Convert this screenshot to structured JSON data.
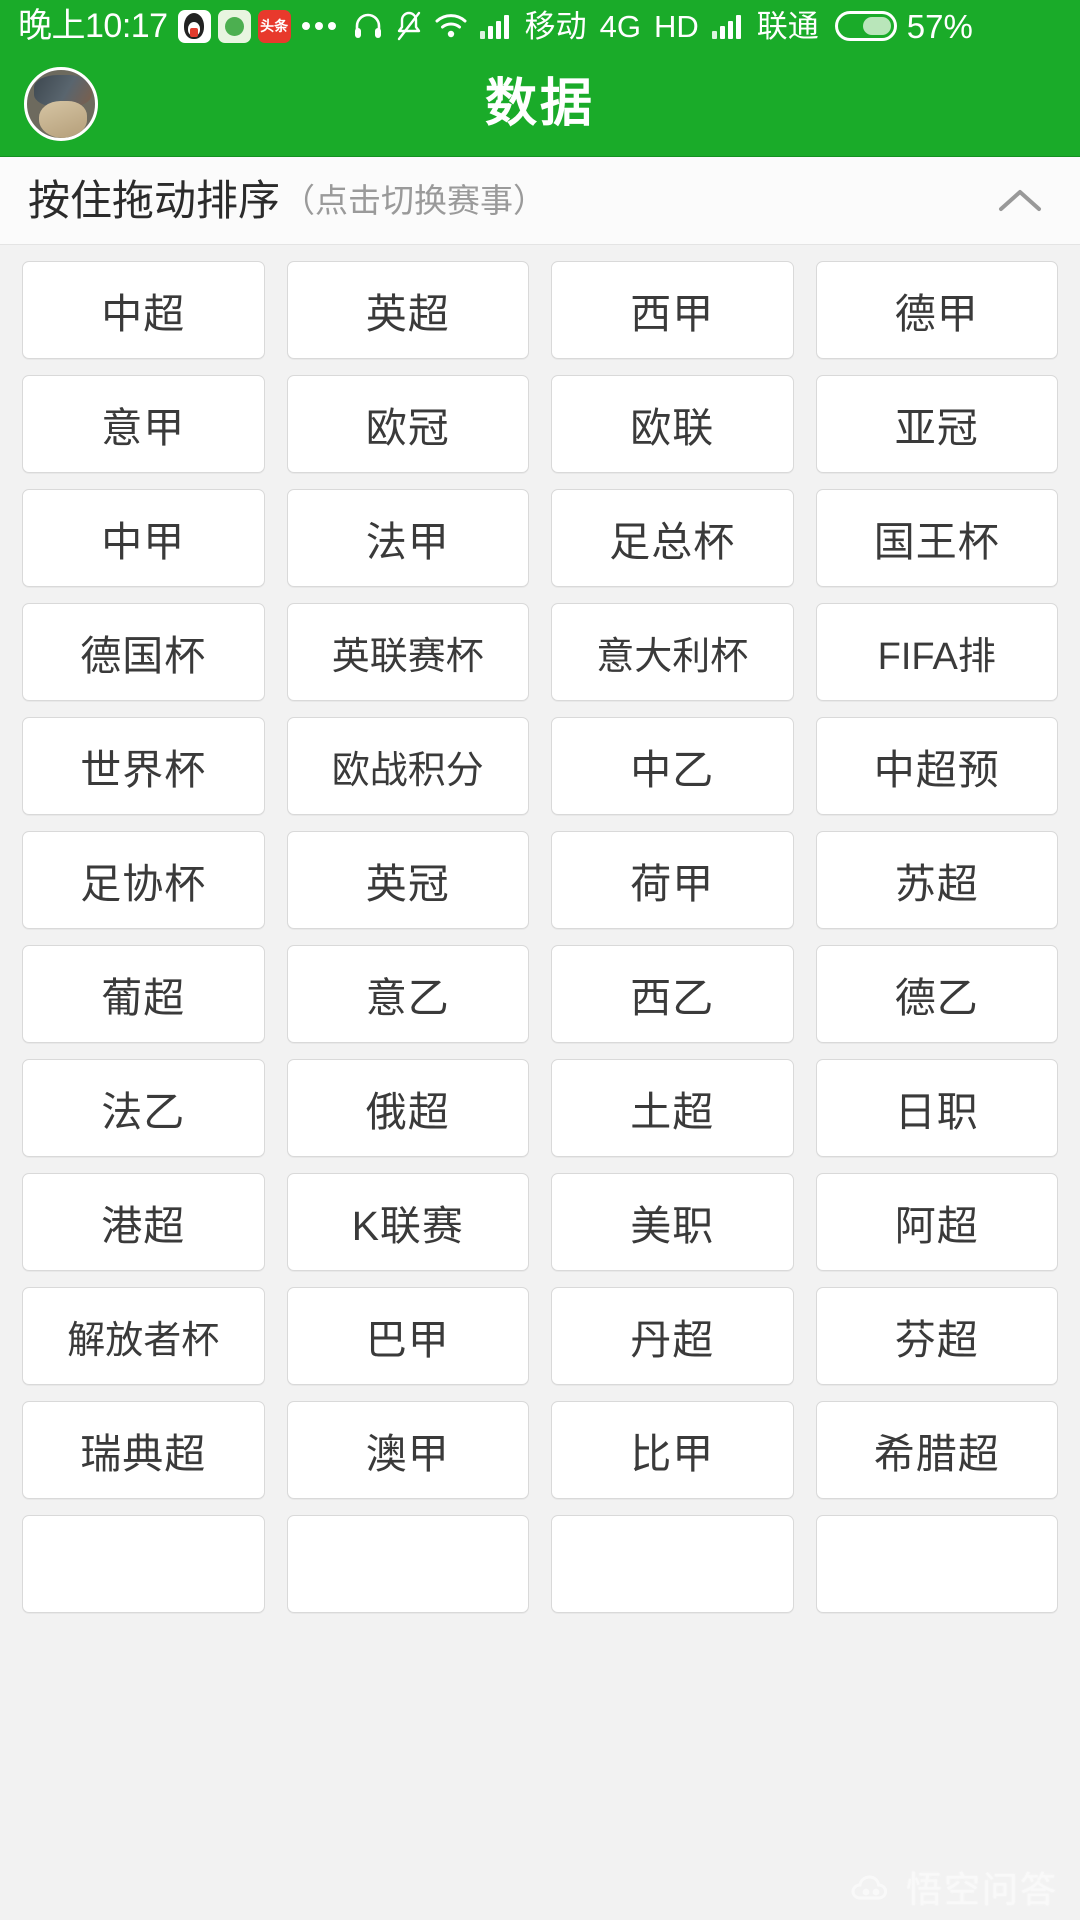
{
  "status_bar": {
    "time": "晚上10:17",
    "app_icons": [
      "qq-icon",
      "wechat-green-icon",
      "toutiao-icon"
    ],
    "more_icon": "more-dots-icon",
    "headset_icon": "headset-icon",
    "mute_icon": "bell-muted-icon",
    "wifi_icon": "wifi-icon",
    "signal_icon": "signal-bars-icon",
    "carrier_primary": "移动",
    "network_type": "4G",
    "hd_label": "HD",
    "signal_icon_2": "signal-bars-icon",
    "carrier_secondary": "联通",
    "battery_icon": "battery-icon",
    "battery_percent": "57%"
  },
  "header": {
    "avatar": "user-avatar",
    "title": "数据"
  },
  "sort_bar": {
    "main_label": "按住拖动排序",
    "sub_label": "（点击切换赛事）",
    "collapse_icon": "chevron-up-icon"
  },
  "grid": {
    "columns": 4,
    "items": [
      {
        "label": "中超"
      },
      {
        "label": "英超"
      },
      {
        "label": "西甲"
      },
      {
        "label": "德甲"
      },
      {
        "label": "意甲"
      },
      {
        "label": "欧冠"
      },
      {
        "label": "欧联"
      },
      {
        "label": "亚冠"
      },
      {
        "label": "中甲"
      },
      {
        "label": "法甲"
      },
      {
        "label": "足总杯"
      },
      {
        "label": "国王杯"
      },
      {
        "label": "德国杯"
      },
      {
        "label": "英联赛杯"
      },
      {
        "label": "意大利杯"
      },
      {
        "label": "FIFA排"
      },
      {
        "label": "世界杯"
      },
      {
        "label": "欧战积分"
      },
      {
        "label": "中乙"
      },
      {
        "label": "中超预"
      },
      {
        "label": "足协杯"
      },
      {
        "label": "英冠"
      },
      {
        "label": "荷甲"
      },
      {
        "label": "苏超"
      },
      {
        "label": "葡超"
      },
      {
        "label": "意乙"
      },
      {
        "label": "西乙"
      },
      {
        "label": "德乙"
      },
      {
        "label": "法乙"
      },
      {
        "label": "俄超"
      },
      {
        "label": "土超"
      },
      {
        "label": "日职"
      },
      {
        "label": "港超"
      },
      {
        "label": "K联赛"
      },
      {
        "label": "美职"
      },
      {
        "label": "阿超"
      },
      {
        "label": "解放者杯"
      },
      {
        "label": "巴甲"
      },
      {
        "label": "丹超"
      },
      {
        "label": "芬超"
      },
      {
        "label": "瑞典超"
      },
      {
        "label": "澳甲"
      },
      {
        "label": "比甲"
      },
      {
        "label": "希腊超"
      },
      {
        "label": ""
      },
      {
        "label": ""
      },
      {
        "label": ""
      },
      {
        "label": ""
      }
    ]
  },
  "watermark": {
    "text": "悟空问答",
    "icon": "wukong-cloud-icon"
  },
  "colors": {
    "brand_green": "#1aab29",
    "page_background": "#f2f2f2",
    "tile_background": "#ffffff",
    "tile_border": "#d9d9d9",
    "text_primary": "#3a3a3a",
    "text_muted": "#9a9a9a"
  }
}
